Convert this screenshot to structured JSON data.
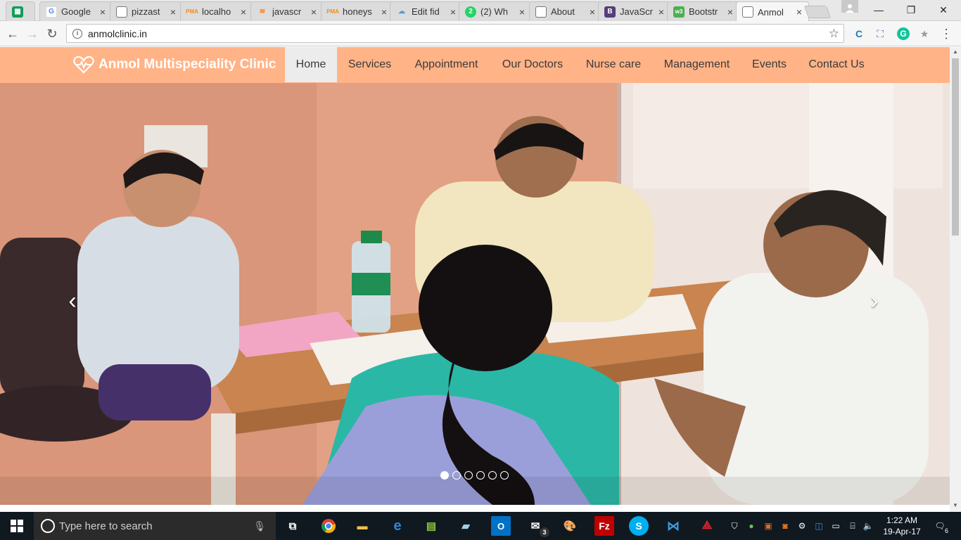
{
  "browser": {
    "tabs": [
      {
        "title": "",
        "icon": "sheets-icon",
        "color": "#0f9d58"
      },
      {
        "title": "Google",
        "icon": "google-icon",
        "color": "#4285f4"
      },
      {
        "title": "pizzast",
        "icon": "page-icon",
        "color": "#888888"
      },
      {
        "title": "localho",
        "icon": "phpmyadmin-icon",
        "color": "#f29111"
      },
      {
        "title": "javascr",
        "icon": "stackoverflow-icon",
        "color": "#f48024"
      },
      {
        "title": "honeys",
        "icon": "phpmyadmin-icon",
        "color": "#f29111"
      },
      {
        "title": "Edit fid",
        "icon": "cloud-icon",
        "color": "#5b9bd5"
      },
      {
        "title": "(2) Wh",
        "icon": "whatsapp-icon",
        "color": "#25d366"
      },
      {
        "title": "About",
        "icon": "page-icon",
        "color": "#888888"
      },
      {
        "title": "JavaScr",
        "icon": "bootstrap-icon",
        "color": "#563d7c"
      },
      {
        "title": "Bootstr",
        "icon": "w3schools-icon",
        "color": "#4caf50"
      },
      {
        "title": "Anmol",
        "icon": "page-icon",
        "color": "#888888",
        "active": true
      }
    ],
    "url": "anmolclinic.in"
  },
  "site": {
    "brand": "Anmol Multispeciality Clinic",
    "nav": [
      {
        "label": "Home",
        "active": true
      },
      {
        "label": "Services"
      },
      {
        "label": "Appointment"
      },
      {
        "label": "Our Doctors"
      },
      {
        "label": "Nurse care"
      },
      {
        "label": "Management"
      },
      {
        "label": "Events"
      },
      {
        "label": "Contact Us"
      }
    ],
    "nav_color": "#ffb387",
    "carousel": {
      "prev_icon": "chevron-left-icon",
      "next_icon": "chevron-right-icon",
      "slide_count": 6,
      "active_slide": 1
    }
  },
  "taskbar": {
    "search_placeholder": "Type here to search",
    "time": "1:22 AM",
    "date": "19-Apr-17",
    "outlook_badge": "3",
    "notification_count": "6"
  }
}
